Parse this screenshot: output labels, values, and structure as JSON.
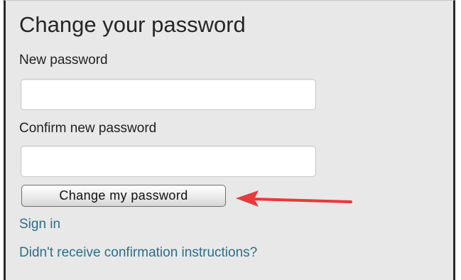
{
  "form": {
    "title": "Change your password",
    "new_password_label": "New password",
    "new_password_value": "",
    "confirm_password_label": "Confirm new password",
    "confirm_password_value": "",
    "submit_label": "Change my password"
  },
  "links": {
    "sign_in": "Sign in",
    "confirmation_help": "Didn't receive confirmation instructions?"
  },
  "annotation": {
    "arrow_icon": "left-arrow-icon",
    "arrow_color": "#e8393b"
  },
  "colors": {
    "background": "#e8e8e8",
    "link": "#2a6f8a",
    "title_text": "#262626"
  }
}
